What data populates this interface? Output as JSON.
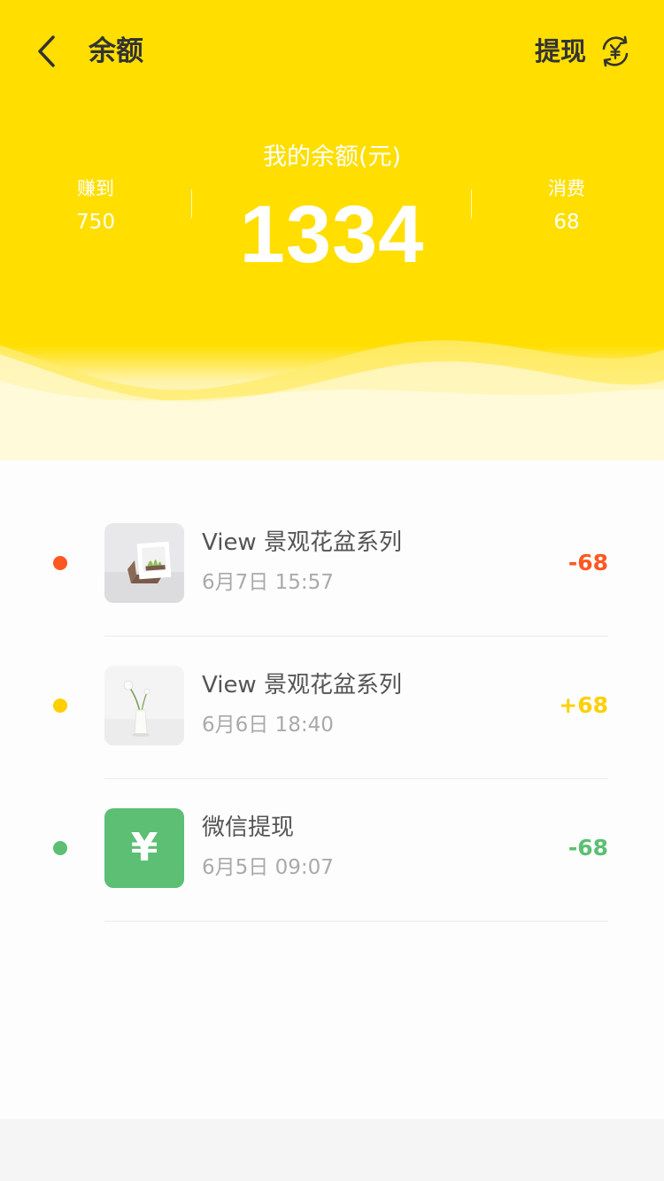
{
  "nav": {
    "back_icon": "chevron-left-icon",
    "title": "余额",
    "withdraw_label": "提现",
    "withdraw_icon": "yuan-exchange-icon"
  },
  "summary": {
    "earned_label": "赚到",
    "earned_value": "750",
    "balance_title": "我的余额(元)",
    "balance_value": "1334",
    "spent_label": "消费",
    "spent_value": "68"
  },
  "colors": {
    "brand_yellow": "#ffde00",
    "red": "#ff5722",
    "yellow": "#ffcf00",
    "green": "#5cbf73"
  },
  "transactions": [
    {
      "title": "View 景观花盆系列",
      "time": "6月7日 15:57",
      "amount": "-68",
      "dot_color": "#ff5722",
      "amount_color": "#ff5722",
      "thumb": "succulent-frame-photo"
    },
    {
      "title": "View 景观花盆系列",
      "time": "6月6日 18:40",
      "amount": "+68",
      "dot_color": "#ffcf00",
      "amount_color": "#ffcf00",
      "thumb": "flower-vase-photo"
    },
    {
      "title": "微信提现",
      "time": "6月5日 09:07",
      "amount": "-68",
      "dot_color": "#5cbf73",
      "amount_color": "#5cbf73",
      "thumb": "yuan-icon",
      "thumb_symbol": "¥"
    }
  ]
}
